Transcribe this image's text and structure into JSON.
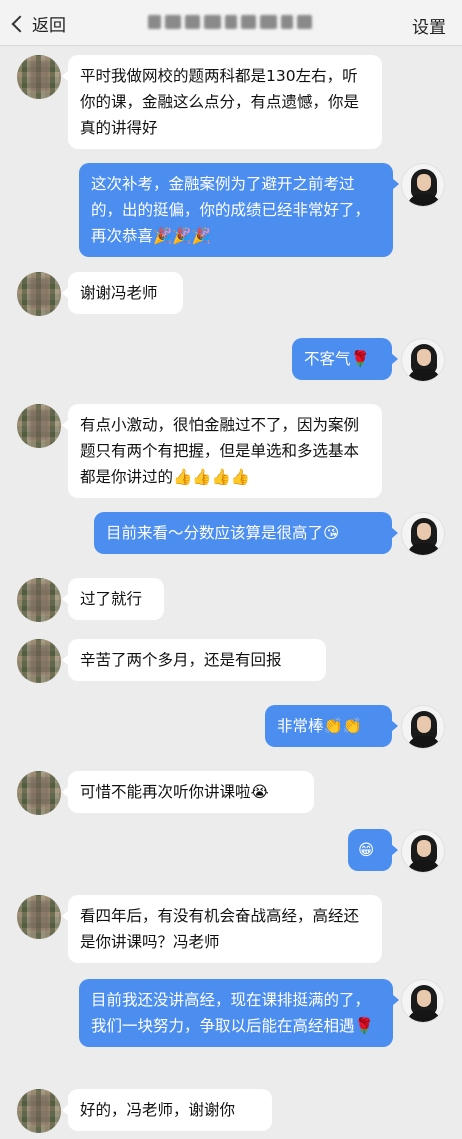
{
  "header": {
    "back_label": "返回",
    "settings_label": "设置"
  },
  "messages": [
    {
      "side": "in",
      "text": "平时我做网校的题两科都是130左右，听你的课，金融这么点分，有点遗憾，你是真的讲得好"
    },
    {
      "side": "out",
      "text": "这次补考，金融案例为了避开之前考过的，出的挺偏，你的成绩已经非常好了，再次恭喜🎉🎉🎉"
    },
    {
      "side": "in",
      "text": "谢谢冯老师"
    },
    {
      "side": "out",
      "text": "不客气🌹"
    },
    {
      "side": "in",
      "text": "有点小激动，很怕金融过不了，因为案例题只有两个有把握，但是单选和多选基本都是你讲过的👍👍👍👍"
    },
    {
      "side": "out",
      "text": "目前来看～分数应该算是很高了😘"
    },
    {
      "side": "in",
      "text": "过了就行"
    },
    {
      "side": "in",
      "text": "辛苦了两个多月，还是有回报"
    },
    {
      "side": "out",
      "text": "非常棒👏👏"
    },
    {
      "side": "in",
      "text": "可惜不能再次听你讲课啦😭"
    },
    {
      "side": "out",
      "text": "😁"
    },
    {
      "side": "in",
      "text": "看四年后，有没有机会奋战高经，高经还是你讲课吗？冯老师"
    },
    {
      "side": "out",
      "text": "目前我还没讲高经，现在课排挺满的了，我们一块努力，争取以后能在高经相遇🌹"
    },
    {
      "side": "in",
      "text": "好的，冯老师，谢谢你"
    }
  ]
}
